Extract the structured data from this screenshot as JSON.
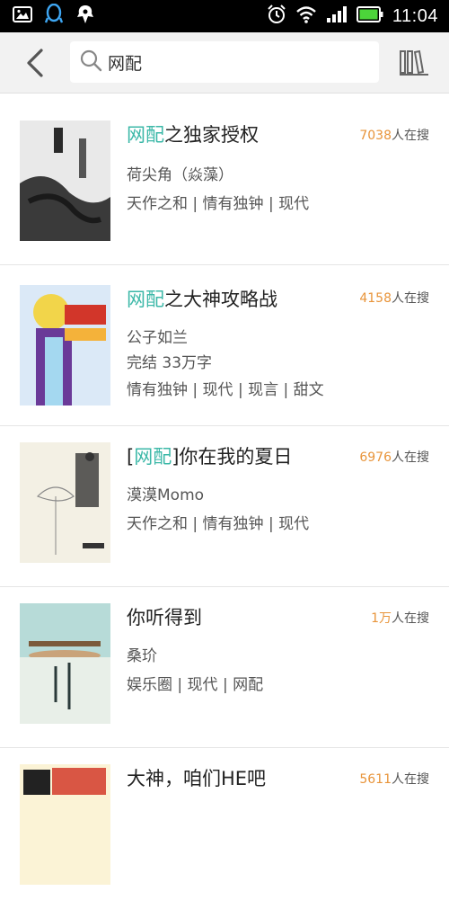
{
  "status_bar": {
    "time": "11:04",
    "left_icons": [
      "image-icon",
      "qq-icon",
      "notification-icon"
    ],
    "right_icons": [
      "alarm-icon",
      "wifi-icon",
      "signal-icon",
      "battery-icon"
    ]
  },
  "header": {
    "search_value": "网配"
  },
  "books": [
    {
      "title_prefix": "",
      "title_highlight": "网配",
      "title_suffix": "之独家授权",
      "count_num": "7038",
      "count_suffix": "人在搜",
      "author": "荷尖角（焱藻）",
      "status": "",
      "tags": "天作之和 | 情有独钟 | 现代",
      "cover_colors": [
        "#e9e9e9",
        "#2c2c2c"
      ]
    },
    {
      "title_prefix": "",
      "title_highlight": "网配",
      "title_suffix": "之大神攻略战",
      "count_num": "4158",
      "count_suffix": "人在搜",
      "author": "公子如兰",
      "status": "完结  33万字",
      "tags": "情有独钟 | 现代 | 现言 | 甜文",
      "cover_colors": [
        "#dbe9f7",
        "#6a3a98"
      ]
    },
    {
      "title_prefix": "[",
      "title_highlight": "网配",
      "title_suffix": "]你在我的夏日",
      "count_num": "6976",
      "count_suffix": "人在搜",
      "author": "漠漠Momo",
      "status": "",
      "tags": "天作之和 | 情有独钟 | 现代",
      "cover_colors": [
        "#f3f0e4",
        "#222222"
      ]
    },
    {
      "title_prefix": "",
      "title_highlight": "",
      "title_suffix": "你听得到",
      "count_num": "1万",
      "count_suffix": "人在搜",
      "author": "桑玠",
      "status": "",
      "tags": "娱乐圈 | 现代 | 网配",
      "cover_colors": [
        "#8cc4c2",
        "#2a3a3a"
      ]
    },
    {
      "title_prefix": "",
      "title_highlight": "",
      "title_suffix": "大神，咱们HE吧",
      "count_num": "5611",
      "count_suffix": "人在搜",
      "author": "",
      "status": "",
      "tags": "",
      "cover_colors": [
        "#fbf3d6",
        "#d23a2a"
      ]
    }
  ],
  "colors": {
    "highlight": "#3cb8a8",
    "count": "#e8943a",
    "topbar": "#f2f2f2"
  }
}
